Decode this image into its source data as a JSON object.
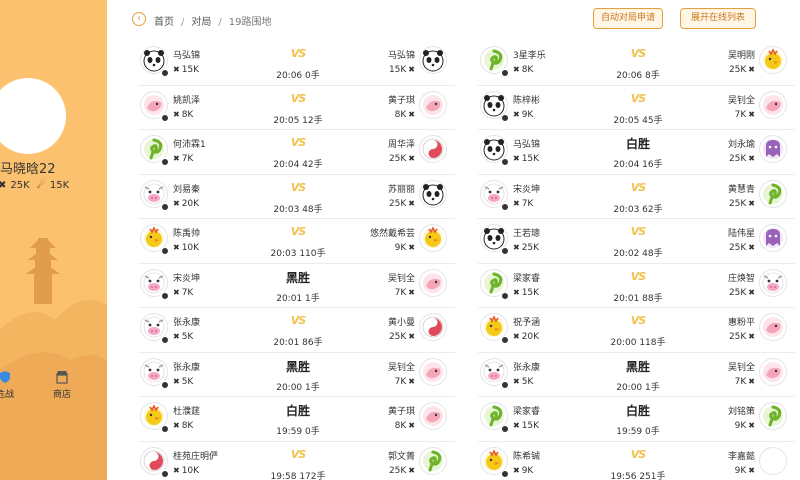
{
  "user": {
    "name": "马晓晗22",
    "rank_label": "25K",
    "score": "15K"
  },
  "side_menu": {
    "battle_label": "危战",
    "shop_label": "商店"
  },
  "breadcrumb": {
    "home": "首页",
    "section": "对局",
    "current": "19路围地"
  },
  "buttons": {
    "auto_apply": "自动对局申请",
    "expand_online": "展开在线列表"
  },
  "labels": {
    "vs": "VS"
  },
  "colors": {
    "accent": "#e8a03c",
    "panel": "#fbc16e",
    "vs": "#f2c14e"
  },
  "games_left": [
    {
      "p1": "马弘锦",
      "r1": "15K",
      "a1": "panda",
      "p2": "马弘锦",
      "r2": "15K",
      "a2": "panda",
      "result": "VS",
      "time": "20:06",
      "moves": "0手"
    },
    {
      "p1": "姚凯泽",
      "r1": "8K",
      "a1": "pink",
      "p2": "黄子琪",
      "r2": "8K",
      "a2": "pink",
      "result": "VS",
      "time": "20:05",
      "moves": "12手"
    },
    {
      "p1": "何沛霖1",
      "r1": "7K",
      "a1": "green",
      "p2": "周华泽",
      "r2": "25K",
      "a2": "yinyang",
      "result": "VS",
      "time": "20:04",
      "moves": "42手"
    },
    {
      "p1": "刘易秦",
      "r1": "20K",
      "a1": "cow",
      "p2": "苏丽丽",
      "r2": "25K",
      "a2": "panda",
      "result": "VS",
      "time": "20:03",
      "moves": "48手"
    },
    {
      "p1": "陈禹帅",
      "r1": "10K",
      "a1": "chick",
      "p2": "悠然戴希芸",
      "r2": "9K",
      "a2": "chick",
      "result": "VS",
      "time": "20:03",
      "moves": "110手"
    },
    {
      "p1": "宋炎坤",
      "r1": "7K",
      "a1": "cow",
      "p2": "吴钊全",
      "r2": "7K",
      "a2": "pink",
      "result": "黑胜",
      "time": "20:01",
      "moves": "1手"
    },
    {
      "p1": "张永康",
      "r1": "5K",
      "a1": "cow",
      "p2": "黄小曼",
      "r2": "25K",
      "a2": "yinyang",
      "result": "VS",
      "time": "20:01",
      "moves": "86手"
    },
    {
      "p1": "张永康",
      "r1": "5K",
      "a1": "cow",
      "p2": "吴钊全",
      "r2": "7K",
      "a2": "pink",
      "result": "黑胜",
      "time": "20:00",
      "moves": "1手"
    },
    {
      "p1": "杜濮莛",
      "r1": "8K",
      "a1": "chick",
      "p2": "黄子琪",
      "r2": "8K",
      "a2": "pink",
      "result": "白胜",
      "time": "19:59",
      "moves": "0手"
    },
    {
      "p1": "桂苑庄明俨",
      "r1": "10K",
      "a1": "yinyang",
      "p2": "郭文菁",
      "r2": "25K",
      "a2": "green",
      "result": "VS",
      "time": "19:58",
      "moves": "172手"
    }
  ],
  "games_right": [
    {
      "p1": "3星李乐",
      "r1": "8K",
      "a1": "green",
      "p2": "吴明刚",
      "r2": "25K",
      "a2": "chick",
      "result": "VS",
      "time": "20:06",
      "moves": "8手"
    },
    {
      "p1": "陈梓彬",
      "r1": "9K",
      "a1": "panda",
      "p2": "吴钊全",
      "r2": "7K",
      "a2": "pink",
      "result": "VS",
      "time": "20:05",
      "moves": "45手"
    },
    {
      "p1": "马弘锦",
      "r1": "15K",
      "a1": "panda",
      "p2": "刘永瑜",
      "r2": "25K",
      "a2": "purple",
      "result": "白胜",
      "time": "20:04",
      "moves": "16手"
    },
    {
      "p1": "宋炎坤",
      "r1": "7K",
      "a1": "cow",
      "p2": "黄慧青",
      "r2": "25K",
      "a2": "green",
      "result": "VS",
      "time": "20:03",
      "moves": "62手"
    },
    {
      "p1": "王若璁",
      "r1": "25K",
      "a1": "panda",
      "p2": "陆伟星",
      "r2": "25K",
      "a2": "purple",
      "result": "VS",
      "time": "20:02",
      "moves": "48手"
    },
    {
      "p1": "梁家睿",
      "r1": "15K",
      "a1": "green",
      "p2": "庄焕智",
      "r2": "25K",
      "a2": "cow",
      "result": "VS",
      "time": "20:01",
      "moves": "88手"
    },
    {
      "p1": "祝予涵",
      "r1": "20K",
      "a1": "chick",
      "p2": "惠粉平",
      "r2": "25K",
      "a2": "pink",
      "result": "VS",
      "time": "20:00",
      "moves": "118手"
    },
    {
      "p1": "张永康",
      "r1": "5K",
      "a1": "cow",
      "p2": "吴钊全",
      "r2": "7K",
      "a2": "pink",
      "result": "黑胜",
      "time": "20:00",
      "moves": "1手"
    },
    {
      "p1": "梁家睿",
      "r1": "15K",
      "a1": "green",
      "p2": "刘铭策",
      "r2": "9K",
      "a2": "green",
      "result": "白胜",
      "time": "19:59",
      "moves": "0手"
    },
    {
      "p1": "陈希铖",
      "r1": "9K",
      "a1": "chick",
      "p2": "李嘉懿",
      "r2": "9K",
      "a2": "blank",
      "result": "VS",
      "time": "19:56",
      "moves": "251手"
    }
  ]
}
